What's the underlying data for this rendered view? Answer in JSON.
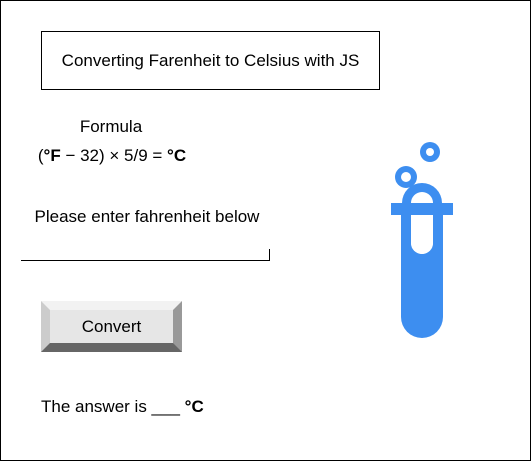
{
  "title": "Converting Farenheit to Celsius with JS",
  "formula": {
    "label": "Formula",
    "open": "(",
    "f_unit": "°F",
    "middle": " − 32) × 5/9 = ",
    "c_unit": "°C"
  },
  "prompt": "Please enter fahrenheit below",
  "input": {
    "value": "",
    "placeholder": ""
  },
  "convert_button": "Convert",
  "answer": {
    "prefix": "The answer is ___ ",
    "unit": "°C"
  },
  "icon": {
    "name": "test-tube-icon",
    "color": "#3d8ef0"
  }
}
